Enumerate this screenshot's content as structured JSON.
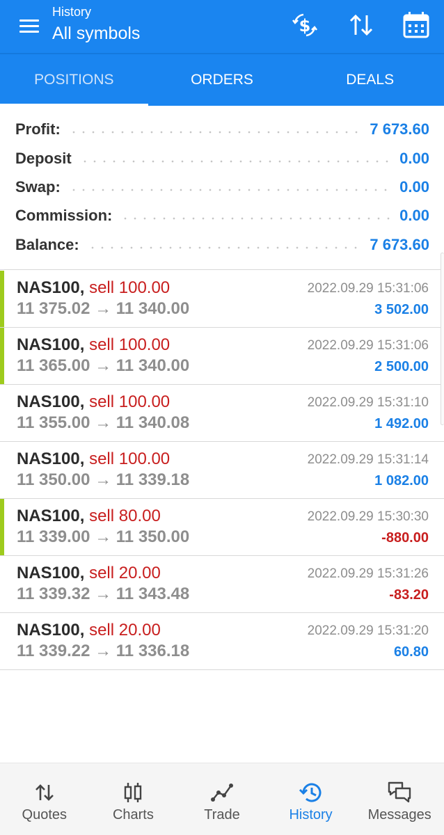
{
  "header": {
    "subtitle": "History",
    "title": "All symbols"
  },
  "tabs": [
    {
      "label": "POSITIONS",
      "active": true
    },
    {
      "label": "ORDERS",
      "active": false
    },
    {
      "label": "DEALS",
      "active": false
    }
  ],
  "summary": {
    "profit_label": "Profit:",
    "profit_value": "7 673.60",
    "deposit_label": "Deposit",
    "deposit_value": "0.00",
    "swap_label": "Swap:",
    "swap_value": "0.00",
    "commission_label": "Commission:",
    "commission_value": "0.00",
    "balance_label": "Balance:",
    "balance_value": "7 673.60"
  },
  "deals": [
    {
      "symbol": "NAS100,",
      "side": "sell 100.00",
      "prices": "11 375.02 → 11 340.00",
      "time": "2022.09.29 15:31:06",
      "profit": "3 502.00",
      "profit_sign": "pos",
      "accent": true
    },
    {
      "symbol": "NAS100,",
      "side": "sell 100.00",
      "prices": "11 365.00 → 11 340.00",
      "time": "2022.09.29 15:31:06",
      "profit": "2 500.00",
      "profit_sign": "pos",
      "accent": true
    },
    {
      "symbol": "NAS100,",
      "side": "sell 100.00",
      "prices": "11 355.00 → 11 340.08",
      "time": "2022.09.29 15:31:10",
      "profit": "1 492.00",
      "profit_sign": "pos",
      "accent": false
    },
    {
      "symbol": "NAS100,",
      "side": "sell 100.00",
      "prices": "11 350.00 → 11 339.18",
      "time": "2022.09.29 15:31:14",
      "profit": "1 082.00",
      "profit_sign": "pos",
      "accent": false
    },
    {
      "symbol": "NAS100,",
      "side": "sell 80.00",
      "prices": "11 339.00 → 11 350.00",
      "time": "2022.09.29 15:30:30",
      "profit": "-880.00",
      "profit_sign": "neg",
      "accent": true
    },
    {
      "symbol": "NAS100,",
      "side": "sell 20.00",
      "prices": "11 339.32 → 11 343.48",
      "time": "2022.09.29 15:31:26",
      "profit": "-83.20",
      "profit_sign": "neg",
      "accent": false
    },
    {
      "symbol": "NAS100,",
      "side": "sell 20.00",
      "prices": "11 339.22 → 11 336.18",
      "time": "2022.09.29 15:31:20",
      "profit": "60.80",
      "profit_sign": "pos",
      "accent": false
    }
  ],
  "nav": [
    {
      "label": "Quotes",
      "icon": "quotes-icon",
      "active": false
    },
    {
      "label": "Charts",
      "icon": "charts-icon",
      "active": false
    },
    {
      "label": "Trade",
      "icon": "trade-icon",
      "active": false
    },
    {
      "label": "History",
      "icon": "history-icon",
      "active": true
    },
    {
      "label": "Messages",
      "icon": "messages-icon",
      "active": false
    }
  ],
  "colors": {
    "header_bg": "#1a85f0",
    "accent_blue": "#1a80e6",
    "loss_red": "#c81e1e",
    "row_accent_green": "#9ecb1d"
  },
  "header_icons": [
    "currency-exchange-icon",
    "sort-icon",
    "calendar-icon"
  ]
}
